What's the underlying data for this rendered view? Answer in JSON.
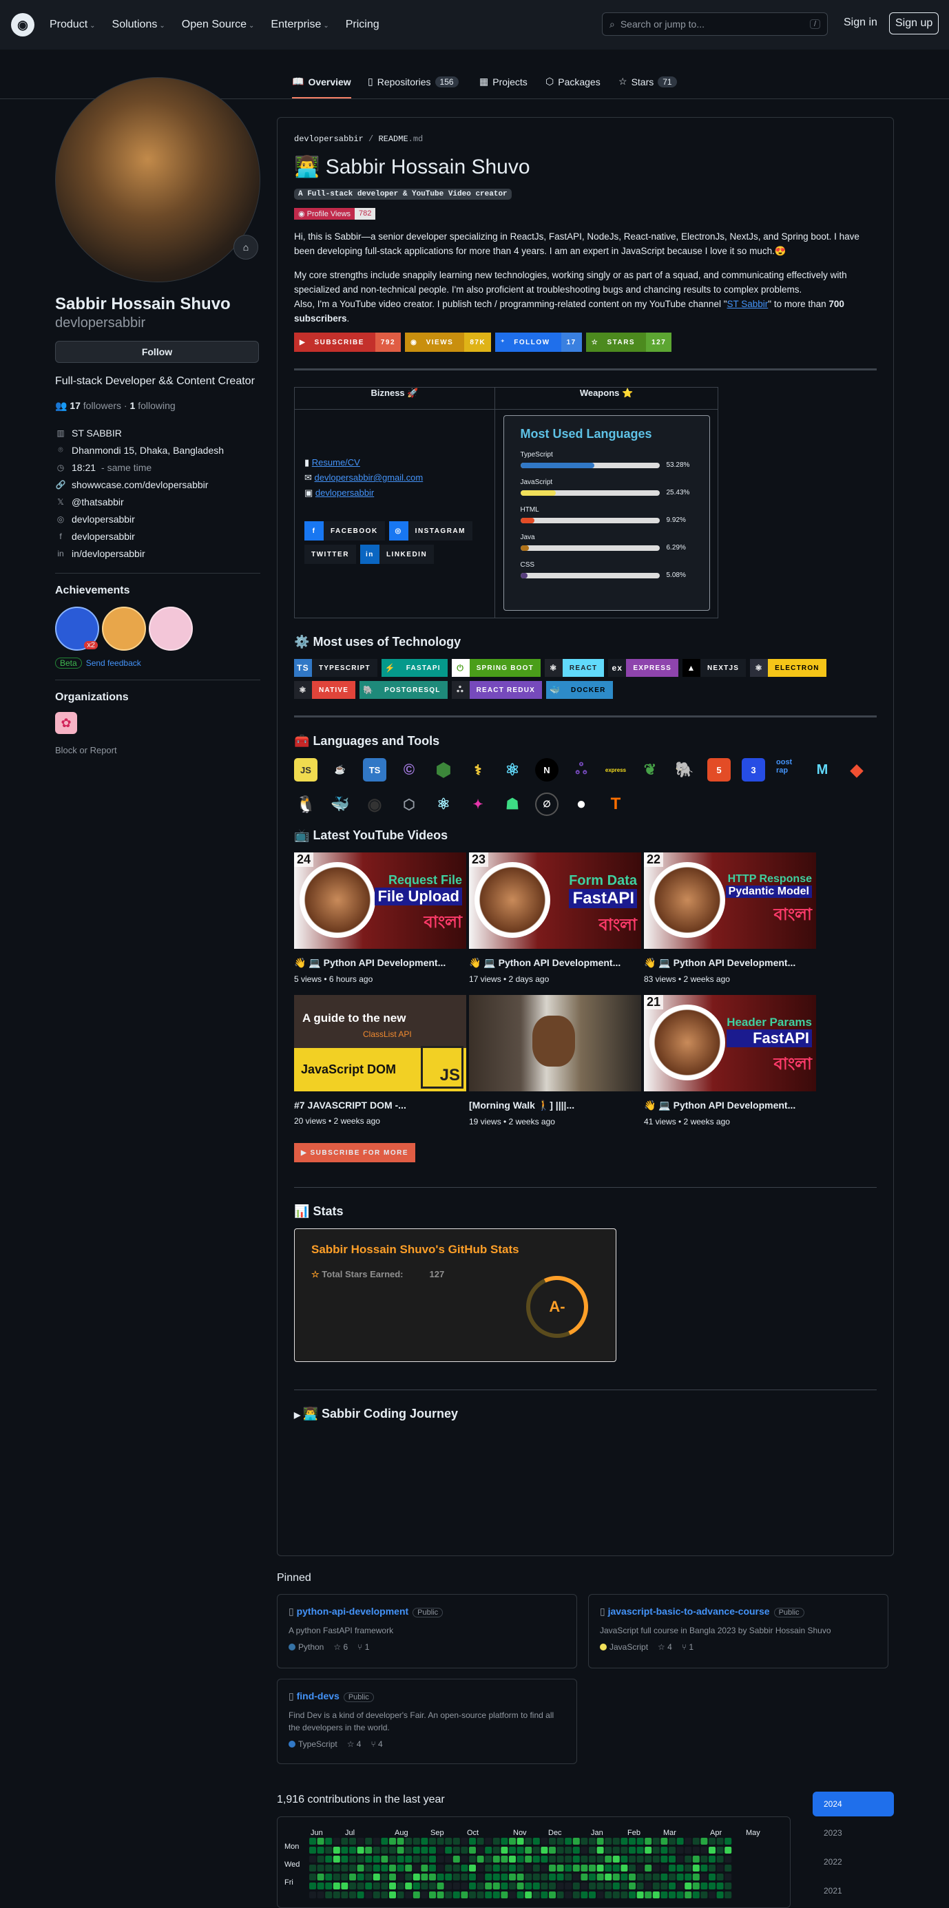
{
  "header": {
    "nav": [
      "Product",
      "Solutions",
      "Open Source",
      "Enterprise",
      "Pricing"
    ],
    "search_placeholder": "Search or jump to...",
    "search_shortcut": "/",
    "signin": "Sign in",
    "signup": "Sign up"
  },
  "tabs": [
    {
      "label": "Overview"
    },
    {
      "label": "Repositories",
      "count": "156"
    },
    {
      "label": "Projects"
    },
    {
      "label": "Packages"
    },
    {
      "label": "Stars",
      "count": "71"
    }
  ],
  "profile": {
    "name": "Sabbir Hossain Shuvo",
    "login": "devlopersabbir",
    "follow": "Follow",
    "bio": "Full-stack Developer && Content Creator",
    "followers": "17",
    "followers_label": "followers",
    "following": "1",
    "following_label": "following",
    "company": "ST SABBIR",
    "location": "Dhanmondi 15, Dhaka, Bangladesh",
    "time": "18:21",
    "time_note": "- same time",
    "website": "showwcase.com/devlopersabbir",
    "twitter": "@thatsabbir",
    "instagram": "devlopersabbir",
    "facebook": "devlopersabbir",
    "linkedin": "in/devlopersabbir",
    "achievements_title": "Achievements",
    "achievement_count": "x2",
    "beta": "Beta",
    "feedback": "Send feedback",
    "orgs_title": "Organizations",
    "block": "Block or Report"
  },
  "readme": {
    "path_user": "devlopersabbir",
    "path_sep": "/",
    "path_file": "README",
    "path_ext": ".md",
    "title": "Sabbir Hossain Shuvo",
    "title_emoji": "👨‍💻",
    "tagline": "A Full-stack developer & YouTube Video creator",
    "profile_views_label": "Profile Views",
    "profile_views": "782",
    "para1": "Hi, this is Sabbir—a senior developer specializing in ReactJs, FastAPI, NodeJs, React-native, ElectronJs, NextJs, and Spring boot. I have been developing full-stack applications for more than 4 years. I am an expert in JavaScript because I love it so much.😍",
    "para2": "My core strengths include snappily learning new technologies, working singly or as part of a squad, and communicating effectively with specialized and non-technical people. I'm also proficient at troubleshooting bugs and chancing results to complex problems.",
    "para3_a": "Also, I'm a YouTube video creator. I publish tech / programming-related content on my YouTube channel \"",
    "para3_link": "ST Sabbir",
    "para3_b": "\" to more than ",
    "para3_bold": "700 subscribers",
    "para3_end": ".",
    "shields": [
      {
        "label": "SUBSCRIBE",
        "value": "792",
        "lc": "#c4302b",
        "vc": "#e05d44"
      },
      {
        "label": "VIEWS",
        "value": "87K",
        "lc": "#c98f0e",
        "vc": "#dfb317"
      },
      {
        "label": "FOLLOW",
        "value": "17",
        "lc": "#1f6feb",
        "vc": "#3a80e0"
      },
      {
        "label": "STARS",
        "value": "127",
        "lc": "#4c8a1e",
        "vc": "#5ca632"
      }
    ],
    "table_h1": "Bizness 🚀",
    "table_h2": "Weapons ⭐",
    "link_resume": "Resume/CV",
    "link_email": "devlopersabbir@gmail.com",
    "link_gh": "devlopersabbir",
    "socials": [
      {
        "label": "FACEBOOK",
        "color": "#1877f2",
        "icon": "f"
      },
      {
        "label": "INSTAGRAM",
        "color": "#e4405f",
        "icon": "◎"
      },
      {
        "label": "TWITTER",
        "color": "#1da1f2",
        "icon": ""
      },
      {
        "label": "LINKEDIN",
        "color": "#0a66c2",
        "icon": "in"
      }
    ],
    "langs_title": "Most Used Languages",
    "langs": [
      {
        "name": "TypeScript",
        "pct": "53.28%",
        "frac": 0.5328,
        "color": "#3178c6"
      },
      {
        "name": "JavaScript",
        "pct": "25.43%",
        "frac": 0.2543,
        "color": "#f1e05a"
      },
      {
        "name": "HTML",
        "pct": "9.92%",
        "frac": 0.0992,
        "color": "#e34c26"
      },
      {
        "name": "Java",
        "pct": "6.29%",
        "frac": 0.0629,
        "color": "#b07219"
      },
      {
        "name": "CSS",
        "pct": "5.08%",
        "frac": 0.0508,
        "color": "#563d7c"
      }
    ],
    "tech_title": "Most uses of Technology",
    "tech_emoji": "⚙️",
    "tech": [
      {
        "label": "TYPESCRIPT",
        "bg": "#161b22",
        "ibg": "#3178c6",
        "fg": "#fff"
      },
      {
        "label": "FASTAPI",
        "bg": "#05998b",
        "ibg": "#05998b",
        "fg": "#fff"
      },
      {
        "label": "SPRING BOOT",
        "bg": "#4a9e1a",
        "ibg": "#fff",
        "fg": "#fff"
      },
      {
        "label": "REACT",
        "bg": "#61dafb",
        "ibg": "#20232a",
        "fg": "#20232a"
      },
      {
        "label": "EXPRESS",
        "bg": "#8e44ad",
        "ibg": "#161b22",
        "fg": "#fff"
      },
      {
        "label": "NEXTJS",
        "bg": "#161b22",
        "ibg": "#000",
        "fg": "#fff"
      },
      {
        "label": "ELECTRON",
        "bg": "#f5c518",
        "ibg": "#2b2e3a",
        "fg": "#000"
      },
      {
        "label": "NATIVE",
        "bg": "#e0443a",
        "ibg": "#20232a",
        "fg": "#fff"
      },
      {
        "label": "POSTGRESQL",
        "bg": "#1e8a7a",
        "ibg": "#1e8a7a",
        "fg": "#fff"
      },
      {
        "label": "REACT REDUX",
        "bg": "#764abc",
        "ibg": "#20232a",
        "fg": "#fff"
      },
      {
        "label": "DOCKER",
        "bg": "#2d8bc9",
        "ibg": "#2d8bc9",
        "fg": "#000"
      }
    ],
    "tools_title": "Languages and Tools",
    "tools_emoji": "🧰",
    "tools_broken_alt": "oost rap",
    "yt_title": "Latest YouTube Videos",
    "yt_emoji": "📺",
    "videos": [
      {
        "num": "24",
        "line1": "Request File",
        "line2": "File Upload",
        "title": "👋 💻 Python API Development...",
        "meta": "5 views • 6 hours ago"
      },
      {
        "num": "23",
        "line1": "Form Data",
        "line2": "FastAPI",
        "title": "👋 💻 Python API Development...",
        "meta": "17 views • 2 days ago"
      },
      {
        "num": "22",
        "line1": "HTTP Response",
        "line2": "Pydantic Model",
        "title": "👋 💻 Python API Development...",
        "meta": "83 views • 2 weeks ago"
      },
      {
        "num": "",
        "line1": "A guide to the new",
        "line2": "ClassList API",
        "title": "#7 JAVASCRIPT DOM -...",
        "meta": "20 views • 2 weeks ago"
      },
      {
        "num": "",
        "line1": "",
        "line2": "",
        "title": "[Morning Walk 🚶] ||||...",
        "meta": "19 views • 2 weeks ago"
      },
      {
        "num": "21",
        "line1": "Header Params",
        "line2": "FastAPI",
        "title": "👋 💻 Python API Development...",
        "meta": "41 views • 2 weeks ago"
      }
    ],
    "bangla": "বাংলা",
    "js_dom": "JavaScript DOM",
    "subscribe_more": "SUBSCRIBE FOR MORE",
    "stats_title": "Stats",
    "stats_emoji": "📊",
    "stats_card_title": "Sabbir Hossain Shuvo's GitHub Stats",
    "stats_stars_label": "Total Stars Earned:",
    "stats_stars": "127",
    "stats_grade": "A-",
    "journey": "Sabbir Coding Journey",
    "journey_emoji": "👨‍💻"
  },
  "pinned": {
    "title": "Pinned",
    "repos": [
      {
        "name": "python-api-development",
        "vis": "Public",
        "desc": "A python FastAPI framework",
        "lang": "Python",
        "lang_color": "#3572a5",
        "stars": "6",
        "forks": "1"
      },
      {
        "name": "javascript-basic-to-advance-course",
        "vis": "Public",
        "desc": "JavaScript full course in Bangla 2023 by Sabbir Hossain Shuvo",
        "lang": "JavaScript",
        "lang_color": "#f1e05a",
        "stars": "4",
        "forks": "1"
      },
      {
        "name": "find-devs",
        "vis": "Public",
        "desc": "Find Dev is a kind of developer's Fair. An open-source platform to find all the developers in the world.",
        "lang": "TypeScript",
        "lang_color": "#3178c6",
        "stars": "4",
        "forks": "4"
      }
    ]
  },
  "contributions": {
    "summary": "1,916 contributions in the last year",
    "months": [
      "Jun",
      "Jul",
      "Aug",
      "Sep",
      "Oct",
      "Nov",
      "Dec",
      "Jan",
      "Feb",
      "Mar",
      "Apr",
      "May"
    ],
    "days": [
      "Mon",
      "Wed",
      "Fri"
    ],
    "years": [
      "2024",
      "2023",
      "2022",
      "2021"
    ]
  }
}
